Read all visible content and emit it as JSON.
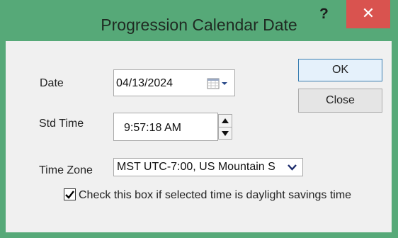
{
  "window": {
    "title": "Progression Calendar Date",
    "help_label": "?",
    "close_label": "✕"
  },
  "labels": {
    "date": "Date",
    "std_time": "Std Time",
    "time_zone": "Time Zone"
  },
  "date_field": {
    "value": "04/13/2024"
  },
  "time_field": {
    "value": "9:57:18 AM"
  },
  "timezone_select": {
    "value": "MST UTC-7:00, US Mountain S"
  },
  "buttons": {
    "ok": "OK",
    "close": "Close"
  },
  "dst_checkbox": {
    "checked": true,
    "label": "Check this box if selected time is daylight savings time"
  },
  "icons": {
    "calendar": "calendar-icon",
    "dropdown": "chevron-down-icon",
    "spin_up": "arrow-up-icon",
    "spin_down": "arrow-down-icon",
    "check": "check-icon"
  },
  "colors": {
    "title_bar": "#56a978",
    "close_button": "#d9534f",
    "client": "#f0f0f0",
    "default_button_border": "#3c7fb1"
  }
}
